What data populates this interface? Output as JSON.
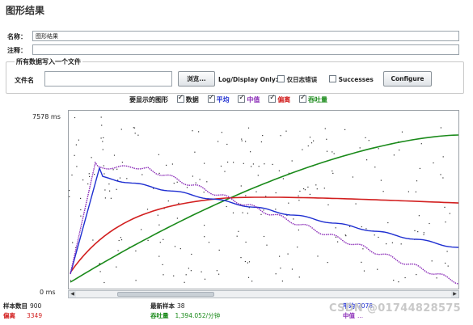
{
  "panel": {
    "title": "图形结果"
  },
  "name_row": {
    "label": "名称：",
    "value": "图形结果"
  },
  "comment_row": {
    "label": "注释：",
    "value": ""
  },
  "file_group": {
    "title": "所有数据写入一个文件",
    "filename_label": "文件名",
    "filename_value": "",
    "browse_label": "浏览...",
    "logdisplay_label": "Log/Display Only:",
    "errors_only_label": "仅日志错误",
    "successes_label": "Successes",
    "configure_label": "Configure"
  },
  "legend": {
    "prefix": "要显示的图形",
    "items": [
      {
        "label": "数据",
        "color": "#222222",
        "checked": true
      },
      {
        "label": "平均",
        "color": "#1f2fd1",
        "checked": true
      },
      {
        "label": "中值",
        "color": "#8a2bb7",
        "checked": true
      },
      {
        "label": "偏离",
        "color": "#d21f1f",
        "checked": true
      },
      {
        "label": "吞吐量",
        "color": "#1a8a1a",
        "checked": true
      }
    ]
  },
  "axis": {
    "y_max_label": "7578 ms",
    "y_min_label": "0 ms"
  },
  "stats": {
    "samples_label": "样本数目",
    "samples_value": "900",
    "deviation_label": "偏离",
    "deviation_value": "3349",
    "latest_label": "最新样本",
    "latest_value": "38",
    "throughput_label": "吞吐量",
    "throughput_value": "1,394.052/分钟",
    "average_label": "平均",
    "average_value": "2078",
    "median_label": "中值",
    "median_value": "..."
  },
  "watermark": "CSDN @01744828575",
  "colors": {
    "average": "#1f2fd1",
    "median": "#8a2bb7",
    "deviation": "#d21f1f",
    "throughput": "#1a8a1a",
    "data": "#222222",
    "deviation_text": "#d21f1f",
    "throughput_text": "#1a8a1a"
  }
}
